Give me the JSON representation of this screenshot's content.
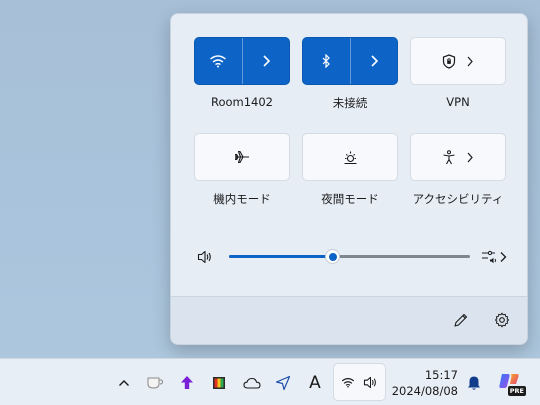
{
  "quick_settings": {
    "tiles": [
      {
        "label": "Room1402"
      },
      {
        "label": "未接続"
      },
      {
        "label": "VPN"
      },
      {
        "label": "機内モード"
      },
      {
        "label": "夜間モード"
      },
      {
        "label": "アクセシビリティ"
      }
    ],
    "volume": {
      "level": 0.43
    }
  },
  "taskbar": {
    "time": "15:17",
    "date": "2024/08/08",
    "text_icon": "A",
    "copilot_badge": "PRE"
  },
  "colors": {
    "accent": "#0d64c6"
  }
}
